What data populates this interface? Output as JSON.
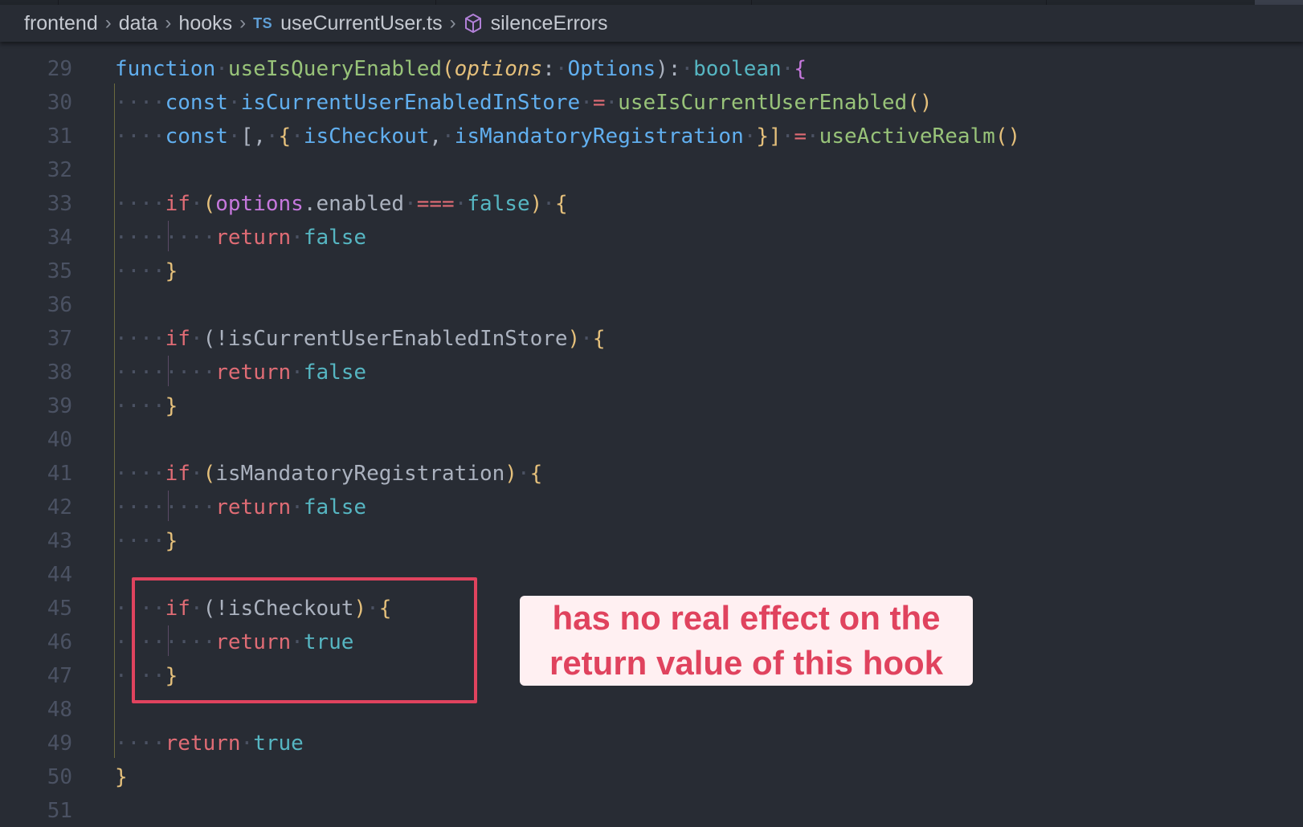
{
  "breadcrumb": {
    "items": [
      {
        "label": "frontend"
      },
      {
        "label": "data"
      },
      {
        "label": "hooks"
      },
      {
        "label": "useCurrentUser.ts",
        "icon": "typescript-file-icon",
        "icon_text": "TS"
      },
      {
        "label": "silenceErrors",
        "icon": "cube-symbol-icon"
      }
    ]
  },
  "editor": {
    "lines": [
      {
        "number": "29",
        "code": "function useIsQueryEnabled(options: Options): boolean {"
      },
      {
        "number": "30",
        "code": "    const isCurrentUserEnabledInStore = useIsCurrentUserEnabled()"
      },
      {
        "number": "31",
        "code": "    const [, { isCheckout, isMandatoryRegistration }] = useActiveRealm()"
      },
      {
        "number": "32",
        "code": ""
      },
      {
        "number": "33",
        "code": "    if (options.enabled === false) {"
      },
      {
        "number": "34",
        "code": "        return false"
      },
      {
        "number": "35",
        "code": "    }"
      },
      {
        "number": "36",
        "code": ""
      },
      {
        "number": "37",
        "code": "    if (!isCurrentUserEnabledInStore) {"
      },
      {
        "number": "38",
        "code": "        return false"
      },
      {
        "number": "39",
        "code": "    }"
      },
      {
        "number": "40",
        "code": ""
      },
      {
        "number": "41",
        "code": "    if (isMandatoryRegistration) {"
      },
      {
        "number": "42",
        "code": "        return false"
      },
      {
        "number": "43",
        "code": "    }"
      },
      {
        "number": "44",
        "code": ""
      },
      {
        "number": "45",
        "code": "    if (!isCheckout) {"
      },
      {
        "number": "46",
        "code": "        return true"
      },
      {
        "number": "47",
        "code": "    }"
      },
      {
        "number": "48",
        "code": ""
      },
      {
        "number": "49",
        "code": "    return true"
      },
      {
        "number": "50",
        "code": "}"
      },
      {
        "number": "51",
        "code": ""
      }
    ]
  },
  "annotation": {
    "line1": "has no real effect on the",
    "line2": "return value of this hook",
    "color": "#e0435e",
    "background": "#fff0f2"
  },
  "theme": {
    "editor_background": "#282c34",
    "keyword": "#c678dd",
    "function": "#98c379",
    "type": "#61afef",
    "boolean": "#56b6c2"
  }
}
